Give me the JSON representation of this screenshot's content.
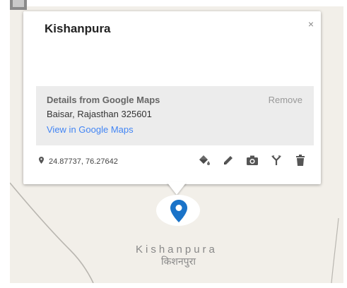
{
  "popup": {
    "title": "Kishanpura",
    "close_label": "×",
    "details": {
      "heading": "Details from Google Maps",
      "remove_label": "Remove",
      "address": "Baisar, Rajasthan 325601",
      "link_label": "View in Google Maps"
    },
    "coordinates": "24.87737, 76.27642",
    "toolbar": {
      "icons": [
        "paint-bucket-icon",
        "pencil-icon",
        "camera-icon",
        "directions-icon",
        "trash-icon"
      ]
    }
  },
  "map": {
    "place_label": "Kishanpura",
    "place_label_local": "किशनपुरा",
    "marker_color": "#1a73c8"
  },
  "colors": {
    "link": "#4285f4",
    "map_background": "#f2efe9",
    "details_background": "#ececec"
  }
}
